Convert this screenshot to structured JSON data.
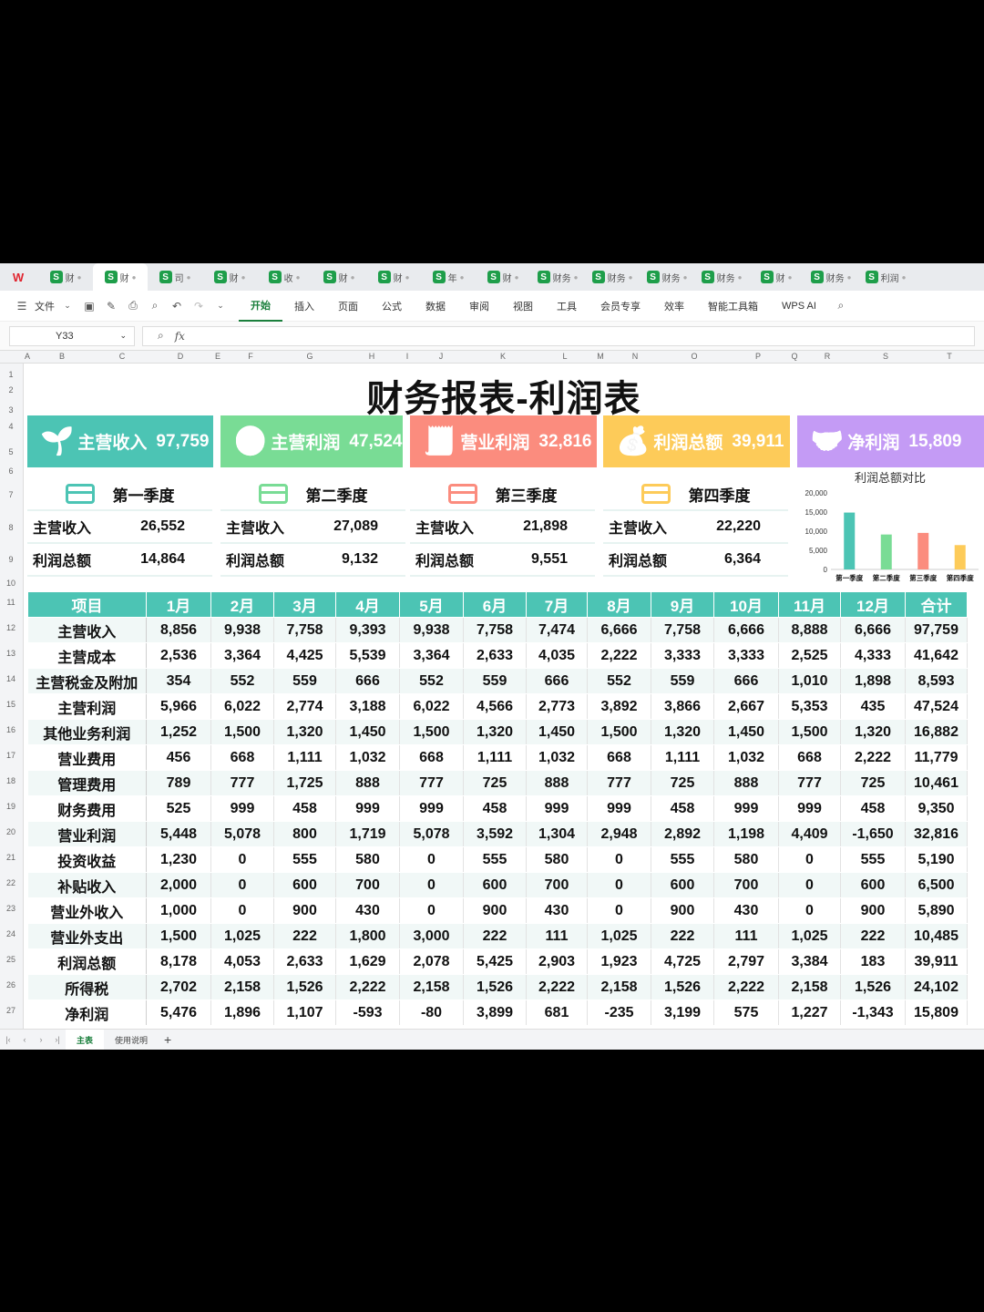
{
  "window": {
    "tabs": [
      "财",
      "财",
      "司",
      "财",
      "收",
      "财",
      "财",
      "年",
      "财",
      "财务",
      "财务",
      "财务",
      "财务",
      "财",
      "财务",
      "利润"
    ],
    "active_tab": 1
  },
  "ribbon": {
    "file": "文件",
    "menus": [
      "开始",
      "插入",
      "页面",
      "公式",
      "数据",
      "审阅",
      "视图",
      "工具",
      "会员专享",
      "效率",
      "智能工具箱",
      "WPS AI"
    ],
    "active_menu": "开始"
  },
  "formula_bar": {
    "cell": "Y33",
    "fx": "fx"
  },
  "columns": [
    "A",
    "B",
    "C",
    "D",
    "E",
    "F",
    "G",
    "H",
    "I",
    "J",
    "K",
    "L",
    "M",
    "N",
    "O",
    "P",
    "Q",
    "R",
    "S",
    "T"
  ],
  "rows": [
    "1",
    "2",
    "3",
    "4",
    "5",
    "6",
    "7",
    "8",
    "9",
    "10",
    "11",
    "12",
    "13",
    "14",
    "15",
    "16",
    "17",
    "18",
    "19",
    "20",
    "21",
    "22",
    "23",
    "24",
    "25",
    "26",
    "27"
  ],
  "title": "财务报表-利润表",
  "kpis": [
    {
      "label": "主营收入",
      "value": "97,759",
      "color": "#4cc4b4"
    },
    {
      "label": "主营利润",
      "value": "47,524",
      "color": "#79dc95"
    },
    {
      "label": "营业利润",
      "value": "32,816",
      "color": "#fb8c7e"
    },
    {
      "label": "利润总额",
      "value": "39,911",
      "color": "#fdcb59"
    },
    {
      "label": "净利润",
      "value": "15,809",
      "color": "#c49bf5"
    }
  ],
  "quarters": [
    {
      "name": "第一季度",
      "row1_label": "主营收入",
      "row1_value": "26,552",
      "row2_label": "利润总额",
      "row2_value": "14,864",
      "color": "#4cc4b4"
    },
    {
      "name": "第二季度",
      "row1_label": "主营收入",
      "row1_value": "27,089",
      "row2_label": "利润总额",
      "row2_value": "9,132",
      "color": "#79dc95"
    },
    {
      "name": "第三季度",
      "row1_label": "主营收入",
      "row1_value": "21,898",
      "row2_label": "利润总额",
      "row2_value": "9,551",
      "color": "#fb8c7e"
    },
    {
      "name": "第四季度",
      "row1_label": "主营收入",
      "row1_value": "22,220",
      "row2_label": "利润总额",
      "row2_value": "6,364",
      "color": "#fdcb59"
    }
  ],
  "chart_data": {
    "type": "bar",
    "title": "利润总额对比",
    "categories": [
      "第一季度",
      "第二季度",
      "第三季度",
      "第四季度"
    ],
    "values": [
      14864,
      9132,
      9551,
      6364
    ],
    "colors": [
      "#4cc4b4",
      "#79dc95",
      "#fb8c7e",
      "#fdcb59"
    ],
    "ylim": [
      0,
      20000
    ],
    "yticks": [
      "0",
      "5,000",
      "10,000",
      "15,000",
      "20,000"
    ]
  },
  "table": {
    "headers": [
      "项目",
      "1月",
      "2月",
      "3月",
      "4月",
      "5月",
      "6月",
      "7月",
      "8月",
      "9月",
      "10月",
      "11月",
      "12月",
      "合计"
    ],
    "rows": [
      [
        "主营收入",
        "8,856",
        "9,938",
        "7,758",
        "9,393",
        "9,938",
        "7,758",
        "7,474",
        "6,666",
        "7,758",
        "6,666",
        "8,888",
        "6,666",
        "97,759"
      ],
      [
        "主营成本",
        "2,536",
        "3,364",
        "4,425",
        "5,539",
        "3,364",
        "2,633",
        "4,035",
        "2,222",
        "3,333",
        "3,333",
        "2,525",
        "4,333",
        "41,642"
      ],
      [
        "主营税金及附加",
        "354",
        "552",
        "559",
        "666",
        "552",
        "559",
        "666",
        "552",
        "559",
        "666",
        "1,010",
        "1,898",
        "8,593"
      ],
      [
        "主营利润",
        "5,966",
        "6,022",
        "2,774",
        "3,188",
        "6,022",
        "4,566",
        "2,773",
        "3,892",
        "3,866",
        "2,667",
        "5,353",
        "435",
        "47,524"
      ],
      [
        "其他业务利润",
        "1,252",
        "1,500",
        "1,320",
        "1,450",
        "1,500",
        "1,320",
        "1,450",
        "1,500",
        "1,320",
        "1,450",
        "1,500",
        "1,320",
        "16,882"
      ],
      [
        "营业费用",
        "456",
        "668",
        "1,111",
        "1,032",
        "668",
        "1,111",
        "1,032",
        "668",
        "1,111",
        "1,032",
        "668",
        "2,222",
        "11,779"
      ],
      [
        "管理费用",
        "789",
        "777",
        "1,725",
        "888",
        "777",
        "725",
        "888",
        "777",
        "725",
        "888",
        "777",
        "725",
        "10,461"
      ],
      [
        "财务费用",
        "525",
        "999",
        "458",
        "999",
        "999",
        "458",
        "999",
        "999",
        "458",
        "999",
        "999",
        "458",
        "9,350"
      ],
      [
        "营业利润",
        "5,448",
        "5,078",
        "800",
        "1,719",
        "5,078",
        "3,592",
        "1,304",
        "2,948",
        "2,892",
        "1,198",
        "4,409",
        "-1,650",
        "32,816"
      ],
      [
        "投资收益",
        "1,230",
        "0",
        "555",
        "580",
        "0",
        "555",
        "580",
        "0",
        "555",
        "580",
        "0",
        "555",
        "5,190"
      ],
      [
        "补贴收入",
        "2,000",
        "0",
        "600",
        "700",
        "0",
        "600",
        "700",
        "0",
        "600",
        "700",
        "0",
        "600",
        "6,500"
      ],
      [
        "营业外收入",
        "1,000",
        "0",
        "900",
        "430",
        "0",
        "900",
        "430",
        "0",
        "900",
        "430",
        "0",
        "900",
        "5,890"
      ],
      [
        "营业外支出",
        "1,500",
        "1,025",
        "222",
        "1,800",
        "3,000",
        "222",
        "111",
        "1,025",
        "222",
        "111",
        "1,025",
        "222",
        "10,485"
      ],
      [
        "利润总额",
        "8,178",
        "4,053",
        "2,633",
        "1,629",
        "2,078",
        "5,425",
        "2,903",
        "1,923",
        "4,725",
        "2,797",
        "3,384",
        "183",
        "39,911"
      ],
      [
        "所得税",
        "2,702",
        "2,158",
        "1,526",
        "2,222",
        "2,158",
        "1,526",
        "2,222",
        "2,158",
        "1,526",
        "2,222",
        "2,158",
        "1,526",
        "24,102"
      ],
      [
        "净利润",
        "5,476",
        "1,896",
        "1,107",
        "-593",
        "-80",
        "3,899",
        "681",
        "-235",
        "3,199",
        "575",
        "1,227",
        "-1,343",
        "15,809"
      ]
    ]
  },
  "sheet_tabs": [
    "主表",
    "使用说明"
  ],
  "add_sheet": "+"
}
